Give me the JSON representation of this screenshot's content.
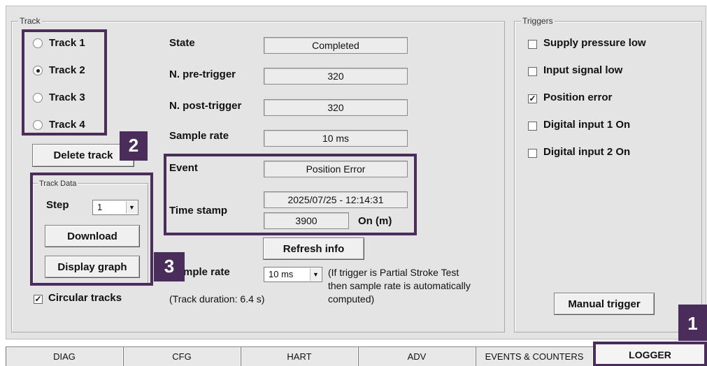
{
  "track_group": {
    "title": "Track",
    "tracks": [
      {
        "label": "Track 1",
        "selected": false
      },
      {
        "label": "Track 2",
        "selected": true
      },
      {
        "label": "Track 3",
        "selected": false
      },
      {
        "label": "Track 4",
        "selected": false
      }
    ],
    "delete_button": "Delete track",
    "fields": {
      "state_label": "State",
      "state_value": "Completed",
      "pre_trigger_label": "N. pre-trigger",
      "pre_trigger_value": "320",
      "post_trigger_label": "N. post-trigger",
      "post_trigger_value": "320",
      "sample_rate_label": "Sample rate",
      "sample_rate_value": "10 ms",
      "event_label": "Event",
      "event_value": "Position Error",
      "timestamp_label": "Time stamp",
      "timestamp_value": "2025/07/25 - 12:14:31",
      "on_value": "3900",
      "on_unit": "On (m)"
    },
    "refresh_button": "Refresh info",
    "sample_rate_setting": {
      "label_partial": "mple rate",
      "selected": "10 ms",
      "note": "(If trigger is Partial Stroke Test then sample rate is automatically computed)",
      "note_lines": [
        "(If trigger is Partial Stroke Test",
        "then sample rate is automatically",
        "computed)"
      ]
    },
    "circular_tracks": {
      "label": "Circular tracks",
      "checked": true
    },
    "track_duration": "(Track duration: 6.4 s)"
  },
  "track_data": {
    "title": "Track Data",
    "step_label": "Step",
    "step_value": "1",
    "download_button": "Download",
    "display_graph_button": "Display graph"
  },
  "triggers": {
    "title": "Triggers",
    "items": [
      {
        "label": "Supply pressure low",
        "checked": false
      },
      {
        "label": "Input signal low",
        "checked": false
      },
      {
        "label": "Position error",
        "checked": true
      },
      {
        "label": "Digital input 1 On",
        "checked": false
      },
      {
        "label": "Digital input 2 On",
        "checked": false
      }
    ],
    "manual_trigger_button": "Manual trigger"
  },
  "tabs": [
    {
      "label": "DIAG",
      "active": false
    },
    {
      "label": "CFG",
      "active": false
    },
    {
      "label": "HART",
      "active": false
    },
    {
      "label": "ADV",
      "active": false
    },
    {
      "label": "EVENTS & COUNTERS",
      "active": false
    },
    {
      "label": "LOGGER",
      "active": true
    }
  ],
  "callouts": {
    "one": "1",
    "two": "2",
    "three": "3"
  },
  "colors": {
    "callout": "#4a2d5a",
    "panel_bg": "#e4e4e4"
  }
}
